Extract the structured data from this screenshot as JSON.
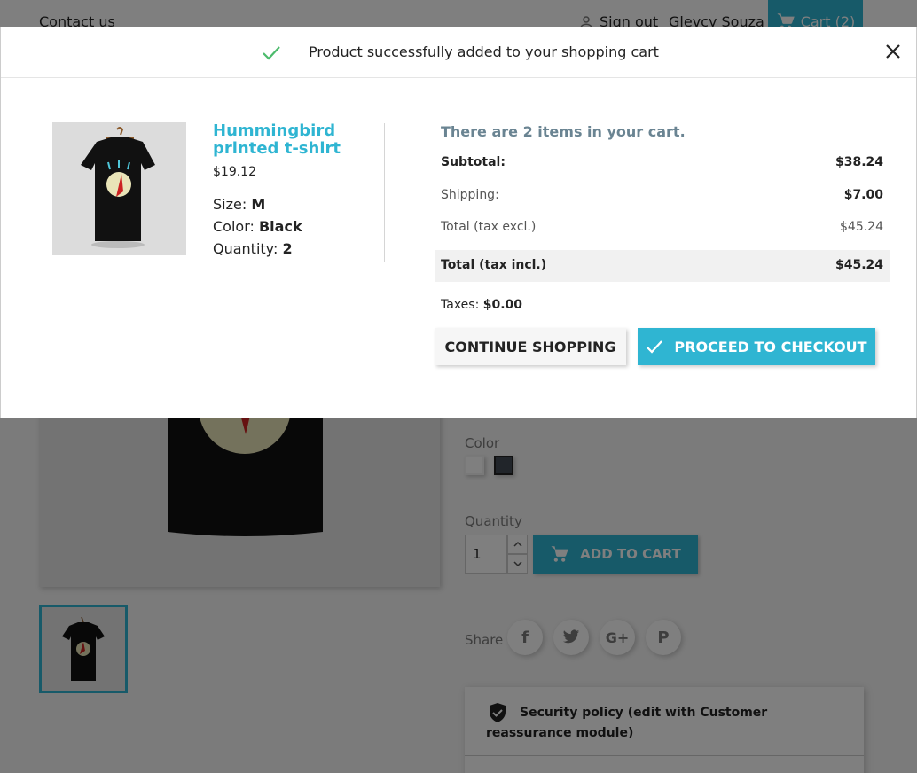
{
  "header": {
    "contact": "Contact us",
    "sign_out": "Sign out",
    "user_name": "Glevcy Souza",
    "cart_label": "Cart (2)"
  },
  "product_page": {
    "color_label": "Color",
    "quantity_label": "Quantity",
    "quantity_value": "1",
    "add_to_cart": "ADD TO CART",
    "share_label": "Share",
    "social_icons": [
      "facebook-icon",
      "twitter-icon",
      "google-plus-icon",
      "pinterest-icon"
    ],
    "reassurance": "Security policy (edit with Customer reassurance module)"
  },
  "modal": {
    "title": "Product successfully added to your shopping cart",
    "product": {
      "name": "Hummingbird printed t-shirt",
      "price": "$19.12",
      "size_label": "Size:",
      "size_value": "M",
      "color_label": "Color:",
      "color_value": "Black",
      "quantity_label": "Quantity:",
      "quantity_value": "2"
    },
    "cart": {
      "count_text": "There are 2 items in your cart.",
      "subtotal_label": "Subtotal:",
      "subtotal_value": "$38.24",
      "shipping_label": "Shipping:",
      "shipping_value": "$7.00",
      "total_excl_label": "Total (tax excl.)",
      "total_excl_value": "$45.24",
      "total_incl_label": "Total (tax incl.)",
      "total_incl_value": "$45.24",
      "taxes_label": "Taxes:",
      "taxes_value": "$0.00"
    },
    "buttons": {
      "continue": "CONTINUE SHOPPING",
      "checkout": "PROCEED TO CHECKOUT"
    }
  },
  "colors": {
    "accent": "#2fb5d2",
    "success": "#4cbb6c",
    "muted_heading": "#6a8492"
  }
}
